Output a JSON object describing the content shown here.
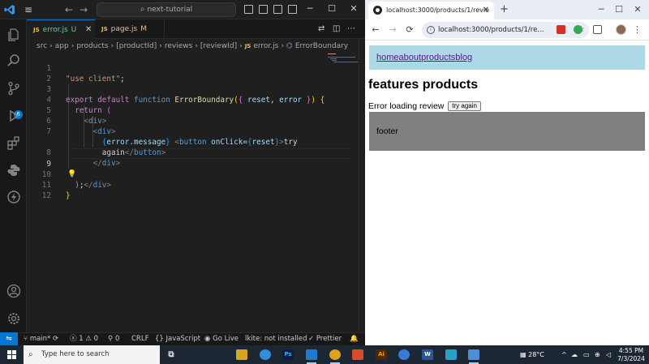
{
  "vscode": {
    "search_text": "next-tutorial",
    "tabs": [
      {
        "name": "error.js",
        "status": "U",
        "color": "#73c991"
      },
      {
        "name": "page.js",
        "status": "M",
        "color": "#e2c08d"
      }
    ],
    "breadcrumb": [
      "src",
      "app",
      "products",
      "[productId]",
      "reviews",
      "[reviewId]",
      "error.js",
      "ErrorBoundary"
    ],
    "line_numbers": [
      "1",
      "2",
      "3",
      "4",
      "5",
      "6",
      "7",
      "",
      "8",
      "9",
      "10",
      "11",
      "12"
    ],
    "code": {
      "l1_str": "\"use client\"",
      "l1_semi": ";",
      "l3_kw1": "export",
      "l3_kw2": "default",
      "l3_kw3": "function",
      "l3_fn": "ErrorBoundary",
      "l3_open": "(",
      "l3_obj_open": "{ ",
      "l3_reset": "reset",
      "l3_comma": ", ",
      "l3_error": "error",
      "l3_obj_close": " }",
      "l3_close": ")",
      "l3_brace": " {",
      "l4_kw": "return",
      "l4_paren": " (",
      "l5_lt": "<",
      "l5_tag": "div",
      "l5_gt": ">",
      "l6_lt": "<",
      "l6_tag": "div",
      "l6_gt": ">",
      "l7_ob": "{",
      "l7_expr": "error.message",
      "l7_cb": "}",
      "l7_lt": " <",
      "l7_tag": "button",
      "l7_attr": " onClick",
      "l7_eq": "=",
      "l7_ob2": "{",
      "l7_reset": "reset",
      "l7_cb2": "}",
      "l7_gt": ">",
      "l7_text": "try",
      "l7w_text": "again",
      "l7w_lt": "</",
      "l7w_tag": "button",
      "l7w_gt": ">",
      "l8_lt": "</",
      "l8_tag": "div",
      "l8_gt": ">",
      "l9_lt": "</",
      "l9_tag": "div",
      "l9_gt": ">",
      "l10_paren": ")",
      "l10_semi": ";",
      "l11_brace": "}"
    },
    "status": {
      "branch": "main*",
      "errors": "1",
      "warnings": "0",
      "ports": "0",
      "eol": "CRLF",
      "language": "JavaScript",
      "golive": "Go Live",
      "linter": "lkite: not installed",
      "prettier": "Prettier"
    }
  },
  "browser": {
    "tab_title": "localhost:3000/products/1/revie",
    "url": "localhost:3000/products/1/re...",
    "page": {
      "nav_links": [
        "home",
        "about",
        "products",
        "blog"
      ],
      "heading": "features products",
      "error_text": "Error loading review",
      "button_label": "try again",
      "footer_text": "footer"
    }
  },
  "taskbar": {
    "search_placeholder": "Type here to search",
    "temperature": "28°C",
    "time": "4:55 PM",
    "date": "7/3/2024",
    "app_colors": [
      "#d9a520",
      "#2f8fd8",
      "#0e1e3f",
      "#1f7ad4",
      "#e0a020",
      "#d84a2b",
      "#4a2a00",
      "#3a7bd5",
      "#2b5797",
      "#2aa0c8",
      "#4a90d9"
    ]
  },
  "colors": {
    "vscode_accent": "#0078d4",
    "nav_bg": "#add8e6",
    "footer_bg": "#808080",
    "link_color": "#551a8b"
  }
}
